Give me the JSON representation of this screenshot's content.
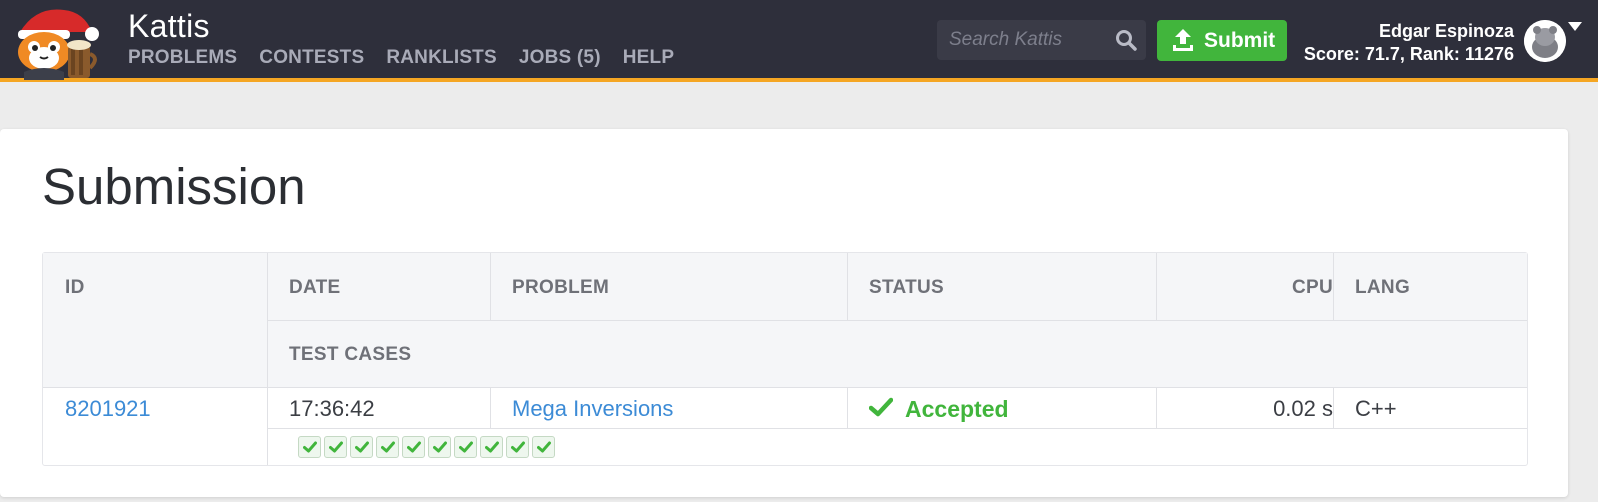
{
  "header": {
    "brand": "Kattis",
    "nav": [
      {
        "label": "PROBLEMS"
      },
      {
        "label": "CONTESTS"
      },
      {
        "label": "RANKLISTS"
      },
      {
        "label": "JOBS (5)"
      },
      {
        "label": "HELP"
      }
    ],
    "search_placeholder": "Search Kattis",
    "submit_label": "Submit",
    "user_name": "Edgar Espinoza",
    "user_stats": "Score: 71.7, Rank: 11276"
  },
  "page": {
    "title": "Submission"
  },
  "table": {
    "headers": {
      "id": "ID",
      "date": "DATE",
      "problem": "PROBLEM",
      "status": "STATUS",
      "cpu": "CPU",
      "lang": "LANG",
      "test_cases": "TEST CASES"
    },
    "row": {
      "id": "8201921",
      "date": "17:36:42",
      "problem": "Mega Inversions",
      "status": "Accepted",
      "cpu": "0.02 s",
      "lang": "C++",
      "test_cases_passed": 10
    }
  },
  "colors": {
    "topbar": "#2e2f3b",
    "accent_border": "#f5a623",
    "success": "#41b53c",
    "link": "#3c8bd6"
  },
  "icons": {
    "logo": "kattis-santa-cat-logo",
    "search": "search-icon",
    "submit": "upload-icon",
    "status": "check-icon",
    "avatar": "user-avatar"
  }
}
